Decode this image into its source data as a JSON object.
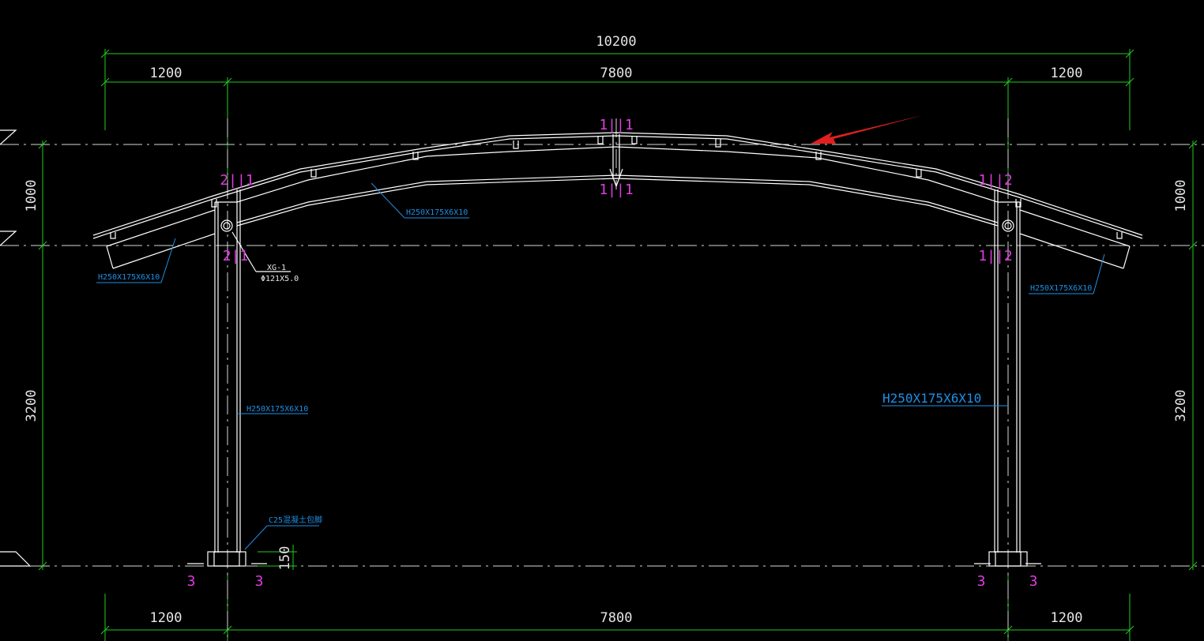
{
  "drawing": {
    "dims": {
      "overall": "10200",
      "top_left": "1200",
      "top_mid": "7800",
      "top_right": "1200",
      "bot_left": "1200",
      "bot_mid": "7800",
      "bot_right": "1200",
      "left_upper": "1000",
      "left_lower": "3200",
      "right_upper": "1000",
      "right_lower": "3200",
      "base": "150"
    },
    "section_marks": {
      "apex_top": "1||1",
      "apex_bottom": "1||1",
      "left_knee_top": "2||1",
      "left_knee_bottom": "2|1",
      "right_knee_top": "1||2",
      "right_knee_bottom": "1||2",
      "base_ll": "3",
      "base_lr": "3",
      "base_rl": "3",
      "base_rr": "3"
    },
    "labels": {
      "rafter": "H250X175X6X10",
      "left_cantilever": "H250X175X6X10",
      "right_cantilever": "H250X175X6X10",
      "left_column": "H250X175X6X10",
      "right_column": "H250X175X6X10",
      "brace": "XG-1",
      "brace_size": "Φ121X5.0",
      "foundation": "C25混凝土包脚"
    },
    "colors": {
      "background": "#000000",
      "dimension": "#22cc22",
      "member": "#ffffff",
      "section_mark": "#e03be0",
      "label": "#1e8fe6",
      "arrow": "#e02020"
    }
  }
}
